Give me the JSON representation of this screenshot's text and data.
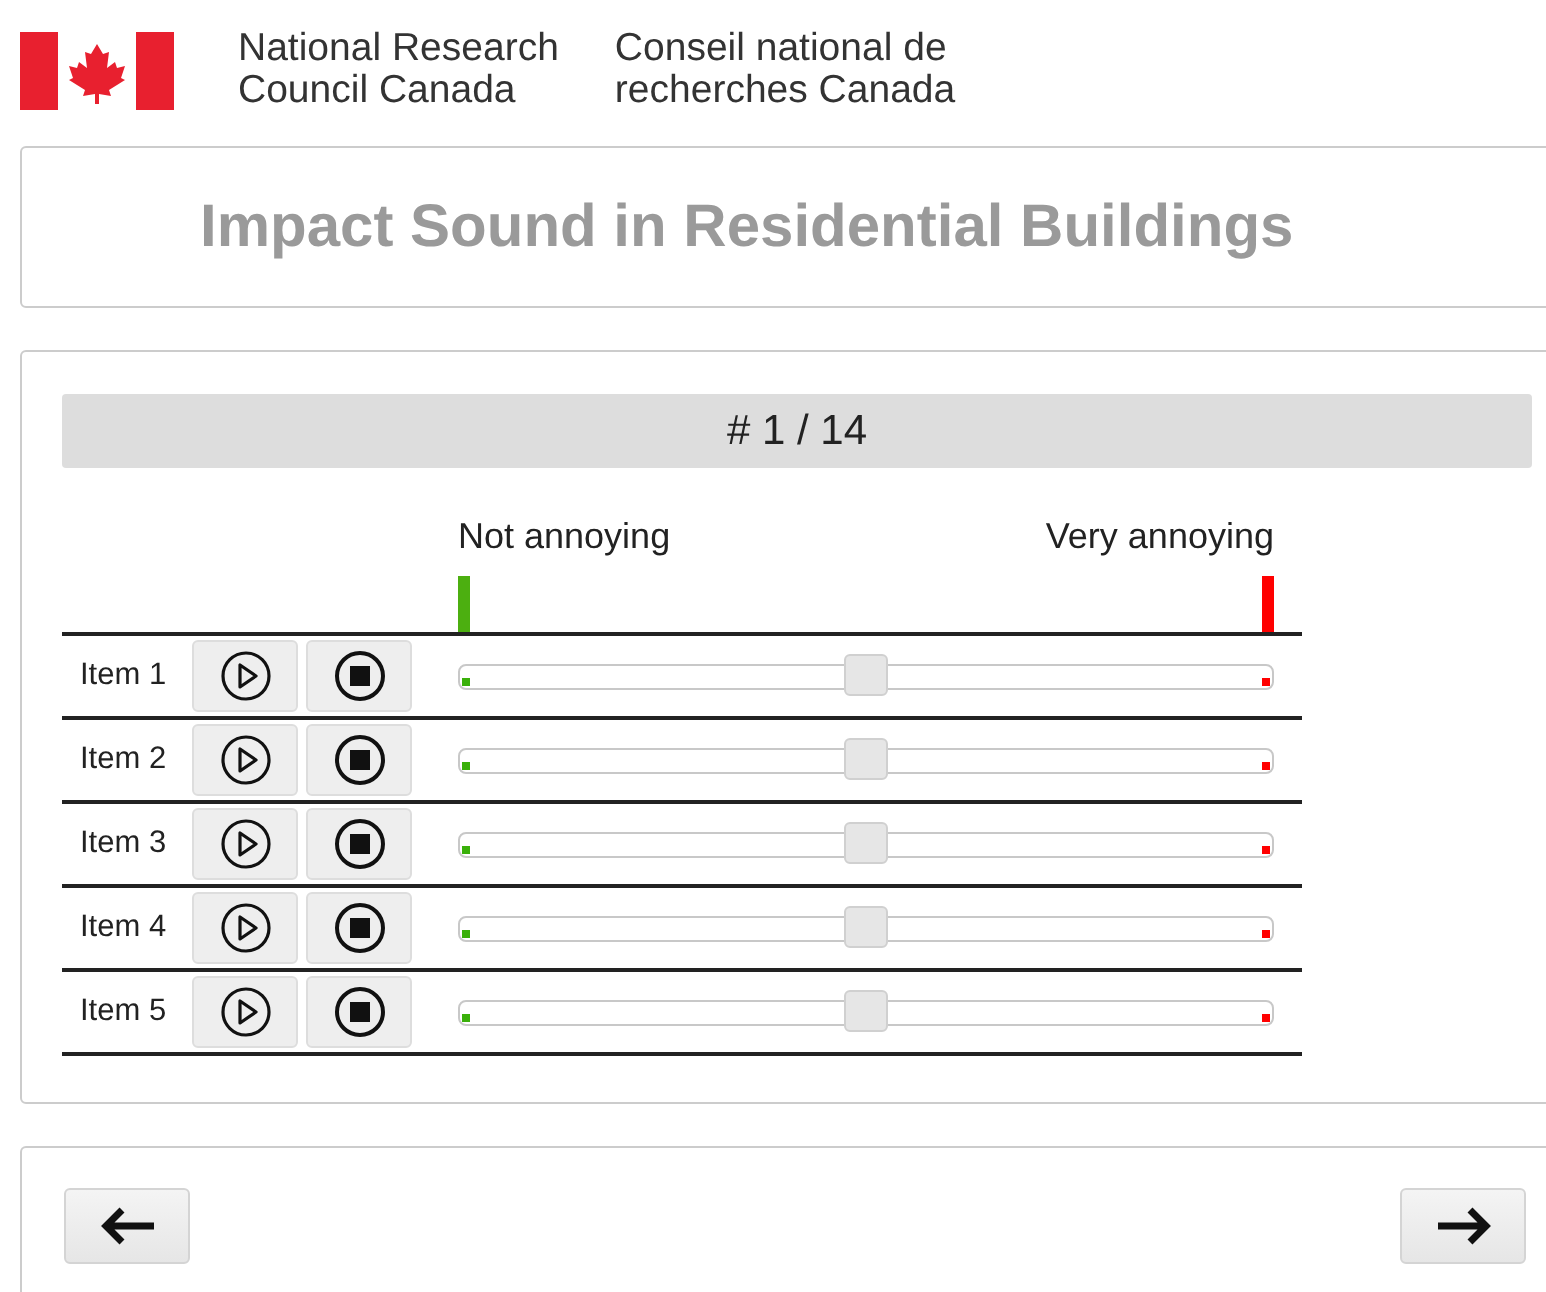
{
  "header": {
    "name_en": [
      "National Research",
      "Council Canada"
    ],
    "name_fr": [
      "Conseil national de",
      "recherches Canada"
    ]
  },
  "title": "Impact Sound in Residential Buildings",
  "counter": "# 1 / 14",
  "scale": {
    "low_label": "Not annoying",
    "high_label": "Very annoying"
  },
  "items": [
    {
      "label": "Item 1",
      "level": 0.5
    },
    {
      "label": "Item 2",
      "level": 0.5
    },
    {
      "label": "Item 3",
      "level": 0.5
    },
    {
      "label": "Item 4",
      "level": 0.5
    },
    {
      "label": "Item 5",
      "level": 0.5
    }
  ]
}
